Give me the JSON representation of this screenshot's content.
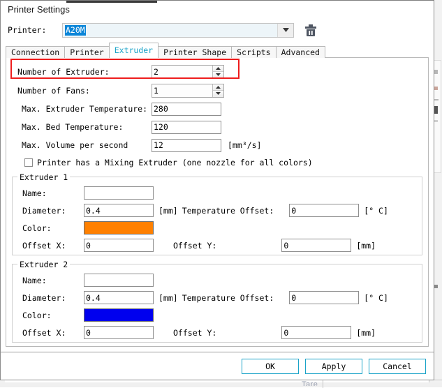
{
  "window": {
    "title": "Printer Settings"
  },
  "printer_selector": {
    "label": "Printer:",
    "value": "A20M",
    "dropdown_icon": "chevron-down-icon",
    "delete_icon": "trash-icon"
  },
  "tabs": [
    {
      "label": "Connection",
      "active": false
    },
    {
      "label": "Printer",
      "active": false
    },
    {
      "label": "Extruder",
      "active": true
    },
    {
      "label": "Printer Shape",
      "active": false
    },
    {
      "label": "Scripts",
      "active": false
    },
    {
      "label": "Advanced",
      "active": false
    }
  ],
  "extruder_tab": {
    "number_of_extruder": {
      "label": "Number of Extruder:",
      "value": "2",
      "highlighted": true
    },
    "number_of_fans": {
      "label": "Number of Fans:",
      "value": "1"
    },
    "max_extruder_temperature": {
      "label": "Max. Extruder Temperature:",
      "value": "280"
    },
    "max_bed_temperature": {
      "label": "Max. Bed Temperature:",
      "value": "120"
    },
    "max_volume_per_second": {
      "label": "Max. Volume per second",
      "value": "12",
      "unit": "[mm³/s]"
    },
    "mixing_extruder": {
      "label": "Printer has a Mixing Extruder (one nozzle for all colors)",
      "checked": false
    },
    "groups": [
      {
        "title": "Extruder 1",
        "name": {
          "label": "Name:",
          "value": ""
        },
        "diameter": {
          "label": "Diameter:",
          "value": "0.4",
          "unit": "[mm]"
        },
        "temperature_offset": {
          "label": "Temperature Offset:",
          "value": "0",
          "unit": "[° C]"
        },
        "color": {
          "label": "Color:",
          "value": "#ff8000"
        },
        "offset_x": {
          "label": "Offset X:",
          "value": "0"
        },
        "offset_y": {
          "label": "Offset Y:",
          "value": "0",
          "unit": "[mm]"
        }
      },
      {
        "title": "Extruder 2",
        "name": {
          "label": "Name:",
          "value": ""
        },
        "diameter": {
          "label": "Diameter:",
          "value": "0.4",
          "unit": "[mm]"
        },
        "temperature_offset": {
          "label": "Temperature Offset:",
          "value": "0",
          "unit": "[° C]"
        },
        "color": {
          "label": "Color:",
          "value": "#0000ee"
        },
        "offset_x": {
          "label": "Offset X:",
          "value": "0"
        },
        "offset_y": {
          "label": "Offset Y:",
          "value": "0",
          "unit": "[mm]"
        }
      }
    ]
  },
  "footer": {
    "ok_label": "OK",
    "apply_label": "Apply",
    "cancel_label": "Cancel"
  },
  "colors": {
    "accent": "#1aa3c8",
    "highlight_box": "#ee1c1c",
    "selection": "#0a85d8",
    "extruder1_color": "#ff8000",
    "extruder2_color": "#0000ee"
  }
}
